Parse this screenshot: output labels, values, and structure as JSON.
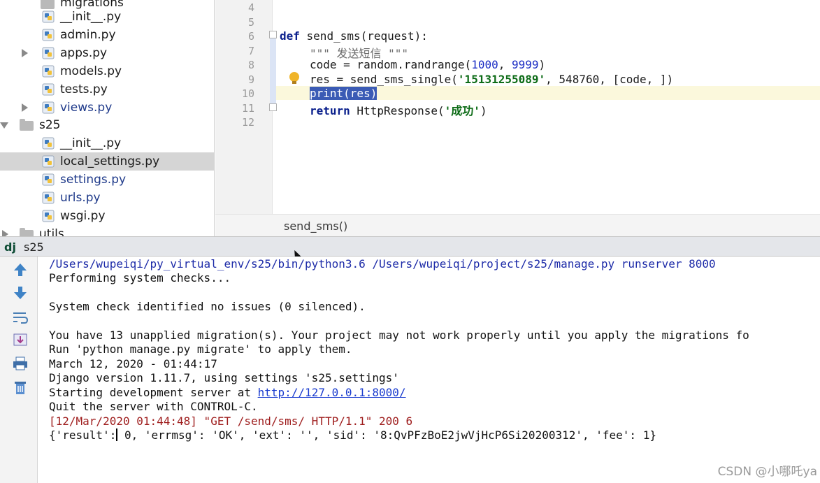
{
  "tree": {
    "items": [
      {
        "label": "migrations",
        "indent": 1
      },
      {
        "label": "__init__.py",
        "indent": 2
      },
      {
        "label": "admin.py",
        "indent": 2
      },
      {
        "label": "apps.py",
        "indent": 2
      },
      {
        "label": "models.py",
        "indent": 2
      },
      {
        "label": "tests.py",
        "indent": 2
      },
      {
        "label": "views.py",
        "indent": 2
      },
      {
        "label": "s25",
        "indent": 0
      },
      {
        "label": "__init__.py",
        "indent": 1
      },
      {
        "label": "local_settings.py",
        "indent": 1
      },
      {
        "label": "settings.py",
        "indent": 1
      },
      {
        "label": "urls.py",
        "indent": 1
      },
      {
        "label": "wsgi.py",
        "indent": 1
      },
      {
        "label": "utils",
        "indent": 0
      }
    ],
    "selected_item": "local_settings.py"
  },
  "editor": {
    "line_numbers": [
      "4",
      "5",
      "6",
      "7",
      "8",
      "9",
      "10",
      "11",
      "12"
    ],
    "lines": {
      "l6_kw": "def",
      "l6_rest": " send_sms(request):",
      "l7_doc": "\"\"\" 发送短信 \"\"\"",
      "l8_a": "code = random.randrange(",
      "l8_n1": "1000",
      "l8_b": ", ",
      "l8_n2": "9999",
      "l8_c": ")",
      "l9_a": "res = send_sms_single(",
      "l9_str": "'15131255089'",
      "l9_b": ", 548760, [code, ])",
      "l10_hl": "print(res)",
      "l11_kw": "return",
      "l11_a": " HttpResponse(",
      "l11_str": "'成功'",
      "l11_b": ")"
    },
    "breadcrumb": "send_sms()"
  },
  "run_panel": {
    "badge": "dj",
    "title": "s25",
    "console": {
      "cmd": "/Users/wupeiqi/py_virtual_env/s25/bin/python3.6 /Users/wupeiqi/project/s25/manage.py runserver 8000",
      "l2": "Performing system checks...",
      "l3": "System check identified no issues (0 silenced).",
      "l4": "You have 13 unapplied migration(s). Your project may not work properly until you apply the migrations fo",
      "l5": "Run 'python manage.py migrate' to apply them.",
      "l6": "March 12, 2020 - 01:44:17",
      "l7": "Django version 1.11.7, using settings 's25.settings'",
      "l8_a": "Starting development server at ",
      "l8_link": "http://127.0.0.1:8000/",
      "l9": "Quit the server with CONTROL-C.",
      "l10": "[12/Mar/2020 01:44:48] \"GET /send/sms/ HTTP/1.1\" 200 6",
      "l11_a": "{'result':",
      "l11_b": " 0, 'errmsg': 'OK', 'ext': '', 'sid': '8:QvPFzBoE2jwVjHcP6Si20200312', 'fee': 1}"
    }
  },
  "watermark": "CSDN @小哪吒ya",
  "colors": {
    "accent": "#3b5bb5",
    "keyword": "#0a1f8c",
    "string": "#0c6b16",
    "number": "#1a2cc4",
    "log_red": "#9e1c1c"
  }
}
